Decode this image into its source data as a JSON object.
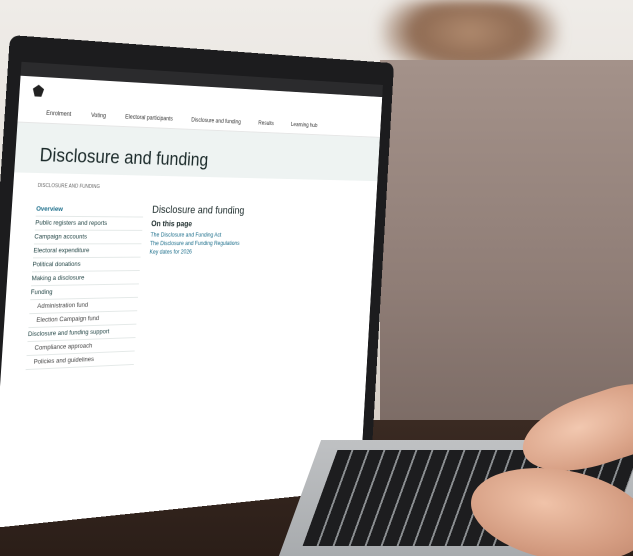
{
  "site": {
    "title": "Disclosure and funding",
    "breadcrumb": "DISCLOSURE AND FUNDING"
  },
  "nav": [
    "Enrolment",
    "Voting",
    "Electoral participants",
    "Disclosure and funding",
    "Results",
    "Learning hub"
  ],
  "sidebar": {
    "items": [
      {
        "label": "Overview",
        "level": 0,
        "active": true
      },
      {
        "label": "Public registers and reports",
        "level": 0
      },
      {
        "label": "Campaign accounts",
        "level": 0
      },
      {
        "label": "Electoral expenditure",
        "level": 0
      },
      {
        "label": "Political donations",
        "level": 0
      },
      {
        "label": "Making a disclosure",
        "level": 0
      },
      {
        "label": "Funding",
        "level": 0
      },
      {
        "label": "Administration fund",
        "level": 1
      },
      {
        "label": "Election Campaign fund",
        "level": 1
      },
      {
        "label": "Disclosure and funding support",
        "level": 0
      },
      {
        "label": "Compliance approach",
        "level": 1
      },
      {
        "label": "Policies and guidelines",
        "level": 1
      }
    ]
  },
  "main": {
    "heading": "Disclosure and funding",
    "subheading": "On this page",
    "links": [
      "The Disclosure and Funding Act",
      "The Disclosure and Funding Regulations",
      "Key dates for 2026"
    ]
  }
}
